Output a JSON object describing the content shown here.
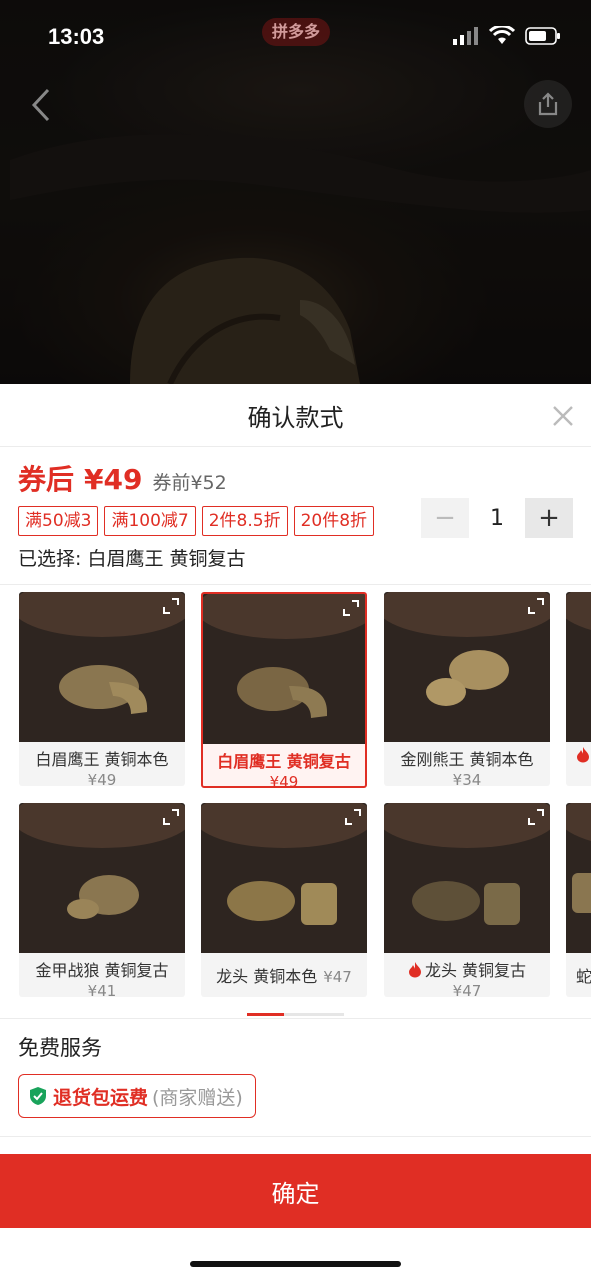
{
  "status_bar": {
    "time": "13:03",
    "app_badge": "拼多多"
  },
  "sheet": {
    "title": "确认款式",
    "price": {
      "label": "券后",
      "value": "¥49",
      "before": "券前¥52"
    },
    "coupons": [
      "满50减3",
      "满100减7",
      "2件8.5折",
      "20件8折"
    ],
    "quantity": "1",
    "quantity_minus": "−",
    "quantity_plus": "+",
    "selected_text": "已选择: 白眉鹰王 黄铜复古",
    "variants": [
      {
        "label": "白眉鹰王 黄铜本色",
        "price": "¥49",
        "selected": false,
        "hot": false
      },
      {
        "label": "白眉鹰王 黄铜复古",
        "price": "¥49",
        "selected": true,
        "hot": false
      },
      {
        "label": "金刚熊王 黄铜本色",
        "price": "¥34",
        "selected": false,
        "hot": false
      },
      {
        "label": "金甲战狼 黄铜复古",
        "price": "¥41",
        "selected": false,
        "hot": false
      },
      {
        "label": "龙头 黄铜本色",
        "price": "¥47",
        "selected": false,
        "hot": false
      },
      {
        "label": "龙头 黄铜复古",
        "price": "¥47",
        "selected": false,
        "hot": true
      },
      {
        "label": "蛇",
        "price": "",
        "selected": false,
        "hot": false
      }
    ],
    "service": {
      "title": "免费服务",
      "name": "退货包运费",
      "note": "(商家赠送)"
    },
    "confirm_label": "确定"
  },
  "colors": {
    "accent": "#e02e24",
    "text": "#222222",
    "muted": "#888888"
  },
  "icons": [
    "back-icon",
    "share-icon",
    "close-icon",
    "expand-icon",
    "flame-icon",
    "shield-check-icon",
    "signal-icon",
    "wifi-icon",
    "battery-icon"
  ]
}
